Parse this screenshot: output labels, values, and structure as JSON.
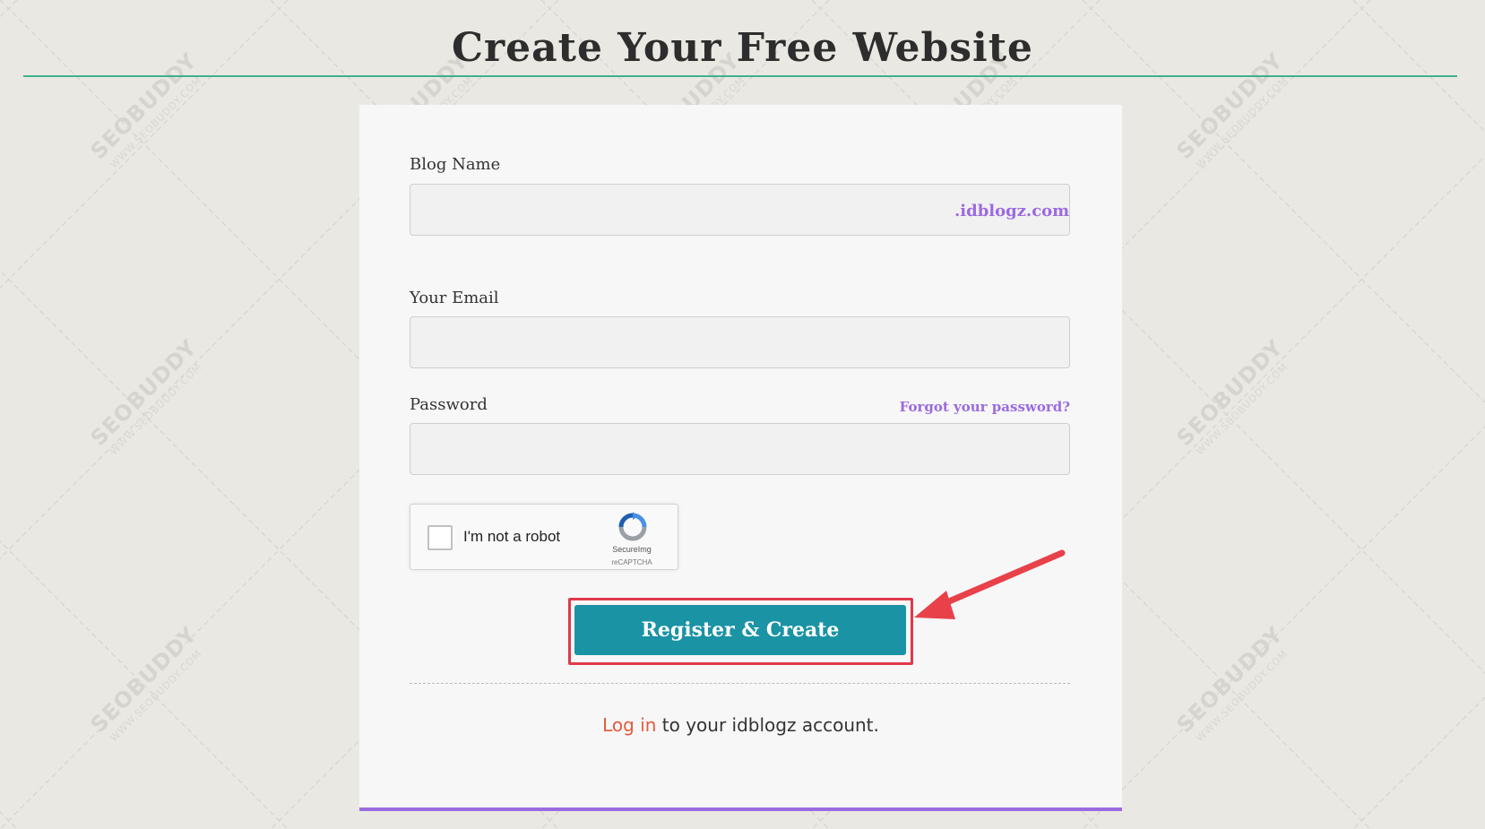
{
  "page": {
    "title": "Create Your Free Website"
  },
  "form": {
    "blog_name_label": "Blog Name",
    "blog_name_value": "",
    "blog_suffix": ".idblogz.com",
    "email_label": "Your Email",
    "email_value": "",
    "password_label": "Password",
    "password_value": "",
    "forgot_password": "Forgot your password?",
    "captcha": {
      "label": "I'm not a robot",
      "checked": false,
      "brand": "SecureImg",
      "sub": "reCAPTCHA"
    },
    "submit_label": "Register & Create",
    "login_link": "Log in",
    "login_suffix": " to your idblogz account."
  },
  "watermark": {
    "brand": "SEOBUDDY",
    "url": "WWW.SEOBUDDY.COM"
  },
  "colors": {
    "background": "#eae8e3",
    "title_rule": "#3cb38a",
    "accent_purple": "#9b6be0",
    "button": "#1a93a5",
    "highlight": "#e0394a",
    "login_link": "#e55a3c"
  }
}
